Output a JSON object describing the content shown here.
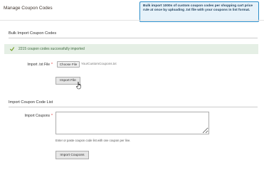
{
  "page": {
    "title": "Manage Coupon Codes"
  },
  "callout": {
    "text": "Bulk import 1000s of custom coupon codes per shopping cart price rule at once by uploading .txt file with your coupons in list format."
  },
  "bulk_import": {
    "section_title": "Bulk Import Coupon Codes",
    "success_message": "2215 coupon codes successfully imported",
    "field_label": "Import .txt File",
    "required_mark": "*",
    "choose_file_label": "Choose File",
    "file_name": "YourCustomCoupons.txt",
    "import_button_label": "Import File"
  },
  "import_list": {
    "section_title": "Import Coupon Code List",
    "field_label": "Import Coupons",
    "required_mark": "*",
    "textarea_value": "",
    "note": "Enter or paste coupon code list with one coupon per line.",
    "import_button_label": "Import Coupons"
  },
  "colors": {
    "success_bg": "#e5efe5",
    "success_icon": "#79a22e",
    "required": "#e22626",
    "callout_border": "#2c8dc9",
    "callout_bg": "#e6f2fa"
  },
  "icons": {
    "success": "check-icon",
    "pointer": "hand-cursor-icon"
  }
}
